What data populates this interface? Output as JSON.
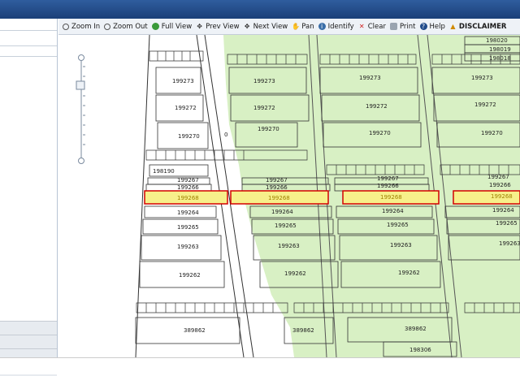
{
  "toolbar": {
    "zoom_in": "Zoom In",
    "zoom_out": "Zoom Out",
    "full_view": "Full View",
    "prev_view": "Prev View",
    "next_view": "Next View",
    "pan": "Pan",
    "identify": "Identify",
    "clear": "Clear",
    "print": "Print",
    "help": "Help",
    "disclaimer": "DISCLAIMER"
  },
  "colors": {
    "top_bar": "#1f4a8a",
    "parcel_fill_green": "#d8f0c4",
    "selected_fill": "#f7f08a",
    "selected_border": "#d40000"
  },
  "parcels": {
    "p199273": "199273",
    "p199272": "199272",
    "p199270": "199270",
    "p0": "0",
    "p198190": "198190",
    "p199267": "199267",
    "p199266": "199266",
    "p199268": "199268",
    "p199264": "199264",
    "p199265": "199265",
    "p199263": "199263",
    "p199262": "199262",
    "p389862": "389862",
    "p198306": "198306",
    "p198020": "198020",
    "p198019": "198019",
    "p198018": "198018"
  }
}
